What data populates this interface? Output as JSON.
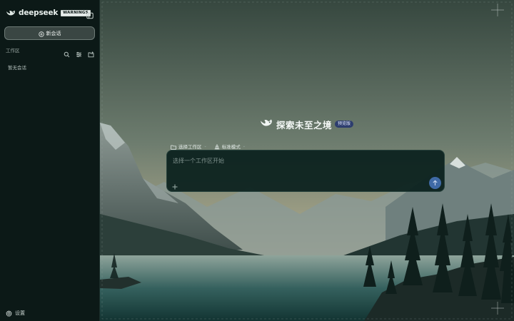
{
  "sidebar": {
    "brand_name": "deepseek",
    "brand_badge": "WARNINGS",
    "new_chat_label": "新会话",
    "workspace_title": "工作区",
    "empty_text": "暂无会话",
    "settings_label": "设置",
    "icons": [
      "whale-logo-icon",
      "sidebar-toggle-icon",
      "plus-circle-icon",
      "search-icon",
      "filter-icon",
      "new-folder-icon",
      "gear-icon"
    ]
  },
  "main": {
    "hero_title": "探索未至之境",
    "hero_tag": "预览版",
    "workspace_select_label": "选择工作区",
    "mode_select_label": "标准模式",
    "composer_placeholder": "选择一个工作区开始",
    "icons": [
      "folder-icon",
      "recycle-icon",
      "plus-icon",
      "arrow-up-icon"
    ]
  },
  "colors": {
    "sidebar_bg": "#0c1917",
    "accent_send": "#3f6aa6",
    "hero_tag_bg": "#2d3d6e",
    "composer_bg": "#0a201d"
  }
}
